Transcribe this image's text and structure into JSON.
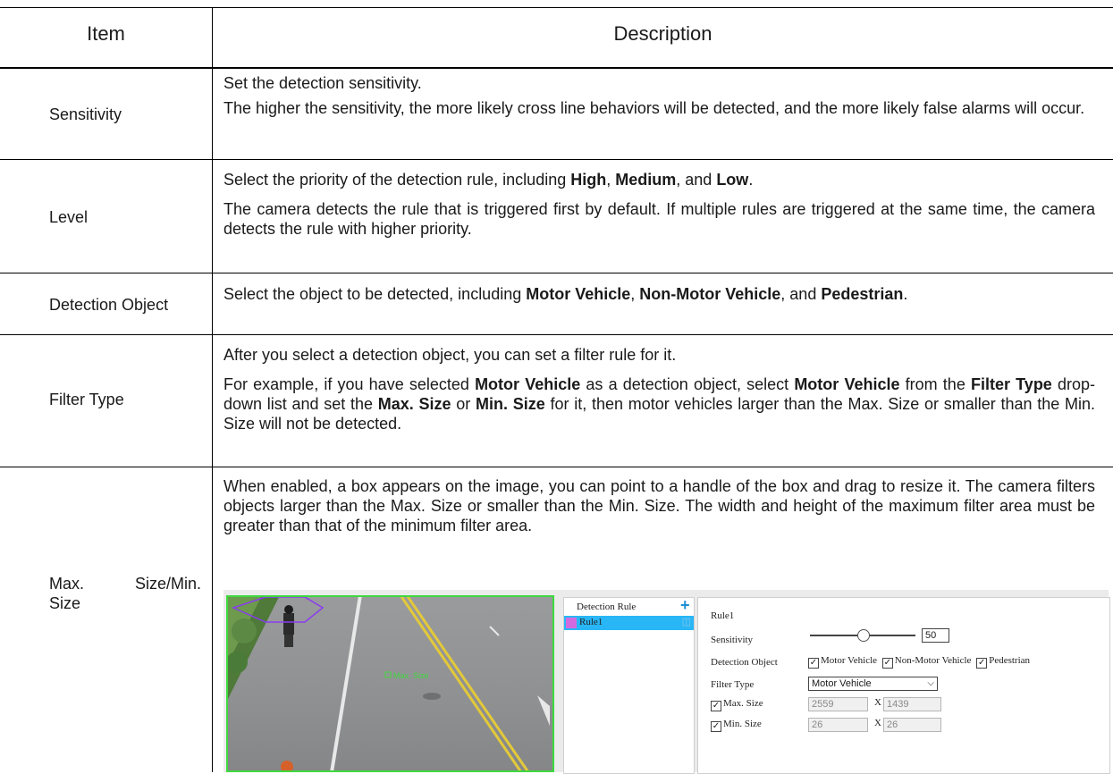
{
  "header": {
    "item": "Item",
    "description": "Description"
  },
  "rows": [
    {
      "item": "Sensitivity",
      "p1": "Set the detection sensitivity.",
      "p2": "The higher the sensitivity, the more likely cross line behaviors will be detected, and the more likely false alarms will occur."
    },
    {
      "item": "Level",
      "p1_a": "Select the priority of the detection rule, including ",
      "p1_b1": "High",
      "p1_c": ", ",
      "p1_b2": "Medium",
      "p1_d": ", and ",
      "p1_b3": "Low",
      "p1_e": ".",
      "p2": "The camera detects the rule that is triggered first by default. If multiple rules are triggered at the same time, the camera detects the rule with higher priority."
    },
    {
      "item": "Detection Object",
      "a": "Select the object to be detected, including ",
      "b1": "Motor Vehicle",
      "c": ", ",
      "b2": "Non-Motor Vehicle",
      "d": ", and ",
      "b3": "Pedestrian",
      "e": "."
    },
    {
      "item": "Filter Type",
      "p1": "After you select a detection object, you can set a filter rule for it.",
      "p2_a": "For example, if you have selected ",
      "p2_b1": "Motor Vehicle",
      "p2_c": " as a detection object, select ",
      "p2_b2": "Motor Vehicle",
      "p2_d": " from the ",
      "p2_b3": "Filter Type",
      "p2_e": " drop-down list and set the ",
      "p2_b4": "Max. Size",
      "p2_f": " or ",
      "p2_b5": "Min. Size",
      "p2_g": " for it, then motor vehicles larger than the Max. Size or smaller than the Min. Size will not be detected."
    },
    {
      "item_1": "Max.",
      "item_2": "Size/Min.",
      "item_3": "Size",
      "p1": "When enabled, a box appears on the image, you can point to a handle of the box and drag to resize it. The camera filters objects larger than the Max. Size or smaller than the Min. Size. The width and height of the maximum filter area must be greater than that of the minimum filter area."
    }
  ],
  "screenshot": {
    "video_overlay_text": "Max. Size",
    "rule_panel": {
      "title": "Detection Rule",
      "add_icon": "plus-icon",
      "rule_name": "Rule1",
      "delete_icon": "trash-icon"
    },
    "settings": {
      "rule_title": "Rule1",
      "sensitivity_label": "Sensitivity",
      "sensitivity_value": "50",
      "sensitivity_level": 0.5,
      "detection_object_label": "Detection Object",
      "objects": [
        "Motor Vehicle",
        "Non-Motor Vehicle",
        "Pedestrian"
      ],
      "filter_type_label": "Filter Type",
      "filter_type_value": "Motor Vehicle",
      "max_size_label": "Max. Size",
      "max_w": "2559",
      "max_h": "1439",
      "min_size_label": "Min. Size",
      "min_w": "26",
      "min_h": "26",
      "x_sep": "X"
    },
    "colors": {
      "selected_row": "#29b6f6",
      "rule_swatch": "#d36be0",
      "box_green": "#3fd93f",
      "polygon": "#8a3cf0"
    }
  }
}
